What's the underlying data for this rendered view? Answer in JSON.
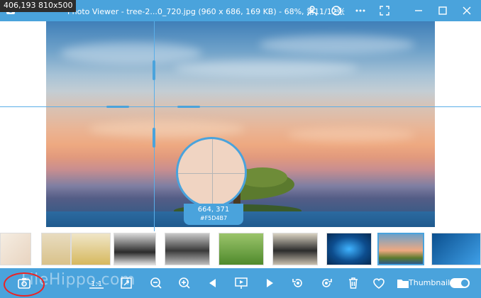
{
  "overlay": {
    "coords_size": "406,193 810x500"
  },
  "window": {
    "title": "Apowersoft Photo Viewer - tree-2...0_720.jpg (960 x 686, 169 KB) - 68%, 第11/12张",
    "title_visible": "Photo Viewer - tree-2...0_720.jpg (960 x 686, 169 KB) - 68%, 第11/12张"
  },
  "titlebar_icons": [
    "user-icon",
    "chat-icon",
    "more-icon",
    "fullscreen-icon",
    "minimize-icon",
    "maximize-icon",
    "close-icon"
  ],
  "magnifier": {
    "coords": "664, 371",
    "hex": "#F5D4B7"
  },
  "thumbnails_count": 10,
  "toolbar": {
    "buttons": [
      "screenshot",
      "ratio-1-1",
      "fit-window",
      "zoom-out",
      "zoom-in",
      "previous",
      "slideshow",
      "next",
      "rotate-left",
      "rotate-right",
      "delete",
      "favorite",
      "folder"
    ],
    "thumbnail_label": "Thumbnail",
    "thumbnail_toggle_on": true
  },
  "watermark": "FileHippo.com",
  "colors": {
    "accent": "#4aa3dc",
    "highlight": "#e22222"
  }
}
